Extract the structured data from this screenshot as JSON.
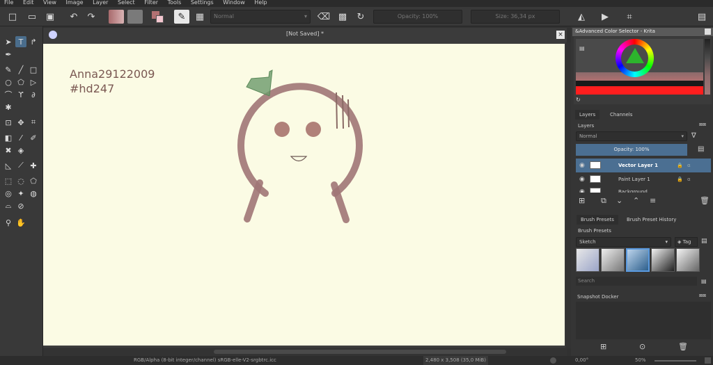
{
  "menu": [
    "File",
    "Edit",
    "View",
    "Image",
    "Layer",
    "Select",
    "Filter",
    "Tools",
    "Settings",
    "Window",
    "Help"
  ],
  "toolbar": {
    "blend_mode": "Normal",
    "opacity": "Opacity: 100%",
    "size": "Size: 36,34 px",
    "fg_color": "#b37173",
    "accent": "#4d8ec5"
  },
  "document_tab": "[Not Saved]  *",
  "canvas_text": {
    "line1": "Anna29122009",
    "line2": "#hd247"
  },
  "color_selector": {
    "title": "&Advanced Color Selector - Krita"
  },
  "layers_docker": {
    "tabs": [
      "Layers",
      "Channels"
    ],
    "title": "Layers",
    "blend": "Normal",
    "opacity": "Opacity:  100%",
    "layers": [
      {
        "name": "Vector Layer 1",
        "selected": true
      },
      {
        "name": "Paint Layer 1",
        "selected": false
      },
      {
        "name": "Background",
        "selected": false
      }
    ]
  },
  "brush_docker": {
    "tabs": [
      "Brush Presets",
      "Brush Preset History"
    ],
    "title": "Brush Presets",
    "tag_combo": "Sketch",
    "tag_button": "Tag",
    "search_placeholder": "Search"
  },
  "snapshot_docker": {
    "title": "Snapshot Docker"
  },
  "status": {
    "color_space": "RGB/Alpha (8-bit integer/channel)  sRGB-elle-V2-srgbtrc.icc",
    "dimensions": "2,480 x 3,508 (35,0 MiB)",
    "rotation": "0,00°",
    "zoom": "50%"
  }
}
